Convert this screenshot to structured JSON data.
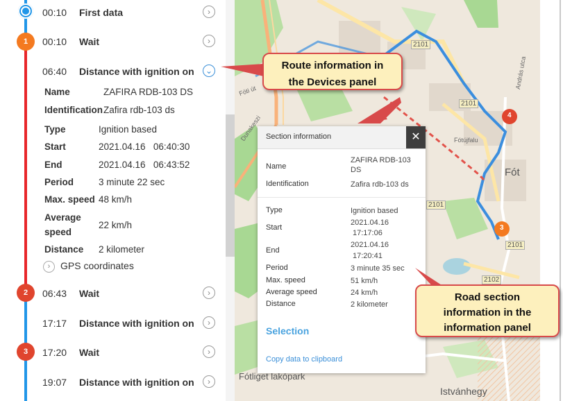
{
  "timeline": {
    "entries": [
      {
        "time": "00:10",
        "label": "First data"
      },
      {
        "time": "00:10",
        "label": "Wait",
        "marker": "1"
      },
      {
        "time": "06:40",
        "label": "Distance with ignition on"
      },
      {
        "time": "06:43",
        "label": "Wait",
        "marker": "2"
      },
      {
        "time": "17:17",
        "label": "Distance with ignition on"
      },
      {
        "time": "17:20",
        "label": "Wait",
        "marker": "3"
      },
      {
        "time": "19:07",
        "label": "Distance with ignition on"
      }
    ],
    "details": {
      "name_key": "Name",
      "name_val": "ZAFIRA RDB-103 DS",
      "id_key": "Identification",
      "id_val": "Zafira rdb-103 ds",
      "type_key": "Type",
      "type_val": "Ignition based",
      "start_key": "Start",
      "start_val": "2021.04.16   06:40:30",
      "end_key": "End",
      "end_val": "2021.04.16   06:43:52",
      "period_key": "Period",
      "period_val": "3 minute 22 sec",
      "maxspeed_key": "Max. speed",
      "maxspeed_val": "48 km/h",
      "avg_key_1": "Average",
      "avg_key_2": "speed",
      "avg_val": "22 km/h",
      "distance_key": "Distance",
      "distance_val": "2 kilometer",
      "gps_label": "GPS coordinates"
    }
  },
  "info_panel": {
    "title": "Section information",
    "close": "✕",
    "name_key": "Name",
    "name_val": "ZAFIRA RDB-103 DS",
    "id_key": "Identification",
    "id_val": "Zafira rdb-103 ds",
    "type_key": "Type",
    "type_val": "Ignition based",
    "start_key": "Start",
    "start_date": "2021.04.16",
    "start_time": "17:17:06",
    "end_key": "End",
    "end_date": "2021.04.16",
    "end_time": "17:20:41",
    "period_key": "Period",
    "period_val": "3 minute 35 sec",
    "maxspeed_key": "Max. speed",
    "maxspeed_val": "51 km/h",
    "avg_key": "Average speed",
    "avg_val": "24 km/h",
    "distance_key": "Distance",
    "distance_val": "2 kilometer",
    "selection": "Selection",
    "copy": "Copy data to clipboard"
  },
  "map": {
    "road_2101_a": "2101",
    "road_2101_b": "2101",
    "road_2101_c": "2101",
    "road_2102": "2102",
    "road_2101_top": "2101",
    "fot": "Fót",
    "fotfalu": "Fótújfalu",
    "fot_ut": "Fóti út",
    "dunakeszi": "Dunakeszi",
    "istvanhegy": "Istvánhegy",
    "fotliget": "Fótliget lakópark",
    "andras_utca": "András utca",
    "marker_3": "3",
    "marker_4": "4"
  },
  "callouts": {
    "devices_1": "Route information in",
    "devices_2": "the Devices panel",
    "info_1": "Road section",
    "info_2": "information in the",
    "info_3": "information panel"
  },
  "colors": {
    "timeline_blue": "#2196e8",
    "timeline_red": "#e8262a",
    "marker_orange": "#f47a20",
    "marker_red": "#e0452e",
    "route_blue": "#3b8ede",
    "route_red_dashed": "#e2524a",
    "callout_fill": "#fdf0bd",
    "callout_border": "#d84a4a"
  }
}
